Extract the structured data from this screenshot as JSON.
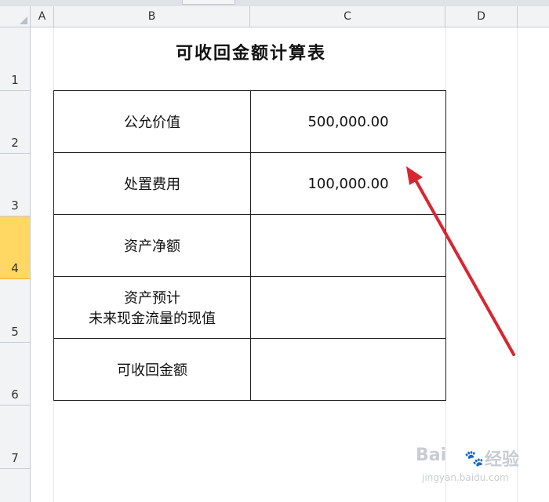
{
  "columns": [
    "A",
    "B",
    "C",
    "D"
  ],
  "rows": [
    "1",
    "2",
    "3",
    "4",
    "5",
    "6",
    "7"
  ],
  "title": "可收回金额计算表",
  "table": [
    {
      "label": "公允价值",
      "value": "500,000.00"
    },
    {
      "label": "处置费用",
      "value": "100,000.00"
    },
    {
      "label": "资产净额",
      "value": ""
    },
    {
      "label_line1": "资产预计",
      "label_line2": "未来现金流量的现值",
      "value": ""
    },
    {
      "label": "可收回金额",
      "value": ""
    }
  ],
  "annotation": {
    "color": "#d9252f"
  },
  "watermark": {
    "logo_left": "Bai",
    "logo_right": "经验",
    "site": "jingyan.baidu.com"
  }
}
